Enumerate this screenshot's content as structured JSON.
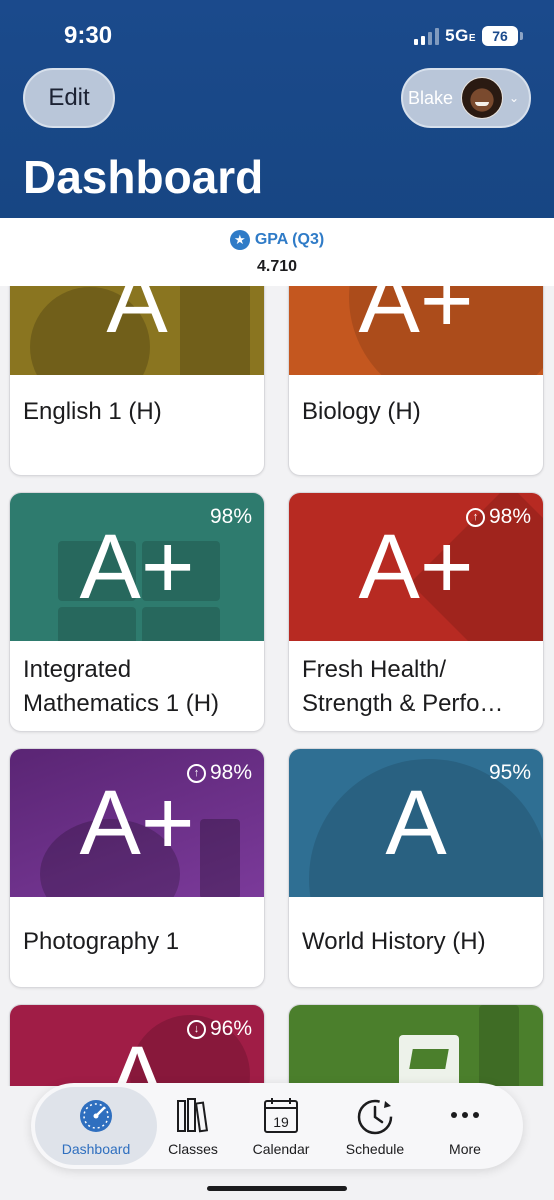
{
  "status_bar": {
    "time": "9:30",
    "network": "5G",
    "network_suffix": "E",
    "battery": "76"
  },
  "header": {
    "edit_label": "Edit",
    "user_name": "Blake",
    "title": "Dashboard"
  },
  "gpa": {
    "label": "GPA (Q3)",
    "value": "4.710"
  },
  "colors": {
    "header": "#1b4a8c",
    "accent": "#2f7bc7",
    "english": "#8a7520",
    "biology": "#c4571f",
    "math": "#2e7b6e",
    "health": "#b72a22",
    "photo": "#6f2f86",
    "history": "#2f6f93",
    "card7": "#a01d46",
    "card8": "#4b7f2c"
  },
  "cards": [
    {
      "course": "English 1 (H)",
      "grade": "A",
      "percent": "",
      "trend": ""
    },
    {
      "course": "Biology (H)",
      "grade": "A+",
      "percent": "",
      "trend": ""
    },
    {
      "course_line1": "Integrated",
      "course_line2": "Mathematics 1 (H)",
      "grade": "A+",
      "percent": "98%",
      "trend": ""
    },
    {
      "course_line1": "Fresh Health/",
      "course_line2": "Strength & Perfo…",
      "grade": "A+",
      "percent": "98%",
      "trend": "up"
    },
    {
      "course": "Photography 1",
      "grade": "A+",
      "percent": "98%",
      "trend": "up"
    },
    {
      "course": "World History (H)",
      "grade": "A",
      "percent": "95%",
      "trend": ""
    },
    {
      "course": "",
      "grade": "A",
      "percent": "96%",
      "trend": "down"
    },
    {
      "course": "",
      "grade": "",
      "percent": "",
      "trend": ""
    }
  ],
  "tabs": [
    {
      "label": "Dashboard",
      "icon": "gauge-icon",
      "active": true
    },
    {
      "label": "Classes",
      "icon": "books-icon"
    },
    {
      "label": "Calendar",
      "icon": "calendar-icon",
      "day": "19"
    },
    {
      "label": "Schedule",
      "icon": "clock-icon"
    },
    {
      "label": "More",
      "icon": "ellipsis-icon"
    }
  ]
}
